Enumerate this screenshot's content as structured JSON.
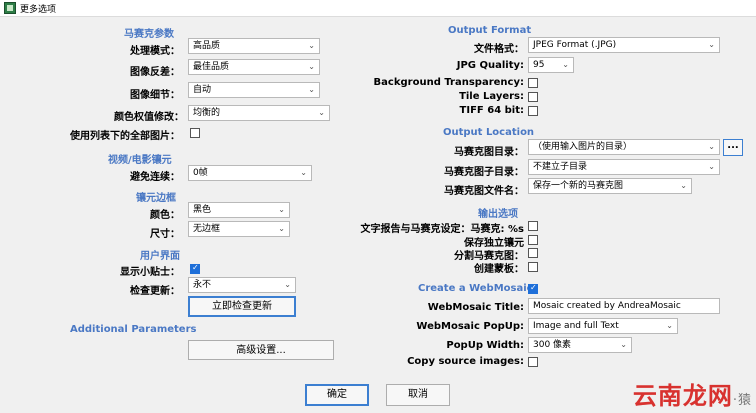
{
  "window": {
    "title": "更多选项"
  },
  "left": {
    "mosaic_params": {
      "title": "马赛克参数",
      "processing_mode": {
        "label": "处理模式：",
        "value": "高品质"
      },
      "image_inversion": {
        "label": "图像反差：",
        "value": "最佳品质"
      },
      "image_detail": {
        "label": "图像细节：",
        "value": "自动"
      },
      "color_weight": {
        "label": "颜色权值修改：",
        "value": "均衡的"
      },
      "use_all": {
        "label": "使用列表下的全部图片：",
        "checked": false
      }
    },
    "video": {
      "title": "视频/电影镶元",
      "avoid_continuous": {
        "label": "避免连续：",
        "value": "0帧"
      }
    },
    "border": {
      "title": "镶元边框",
      "color": {
        "label": "颜色：",
        "value": "黑色"
      },
      "size": {
        "label": "尺寸：",
        "value": "无边框"
      }
    },
    "ui": {
      "title": "用户界面",
      "show_tips": {
        "label": "显示小贴士：",
        "checked": true
      },
      "check_update": {
        "label": "检查更新：",
        "value": "永不"
      },
      "check_now": "立即检查更新"
    },
    "additional": {
      "title": "Additional Parameters",
      "advanced": "高级设置..."
    }
  },
  "right": {
    "output_format": {
      "title": "Output Format",
      "file_format": {
        "label": "文件格式：",
        "value": "JPEG Format (.JPG)"
      },
      "jpg_quality": {
        "label": "JPG Quality:",
        "value": "95"
      },
      "bg_transparency": {
        "label": "Background Transparency:",
        "checked": false
      },
      "tile_layers": {
        "label": "Tile Layers:",
        "checked": false
      },
      "tiff64": {
        "label": "TIFF 64 bit:",
        "checked": false
      }
    },
    "output_location": {
      "title": "Output Location",
      "mosaic_dir": {
        "label": "马赛克图目录：",
        "value": "（使用输入图片的目录）",
        "browse": "..."
      },
      "mosaic_subdir": {
        "label": "马赛克图子目录：",
        "value": "不建立子目录"
      },
      "mosaic_filename": {
        "label": "马赛克图文件名：",
        "value": "保存一个新的马赛克图"
      }
    },
    "output_options": {
      "title": "输出选项",
      "text_report": {
        "label": "文字报告与马赛克设定：马赛克: %s",
        "checked": false
      },
      "save_tiles": {
        "label": "保存独立镶元",
        "checked": false
      },
      "split_mosaic": {
        "label": "分割马赛克图：",
        "checked": false
      },
      "create_mask": {
        "label": "创建蒙板：",
        "checked": false
      }
    },
    "webmosaic": {
      "title": "Create a WebMosaic",
      "checked": true,
      "title_field": {
        "label": "WebMosaic Title:",
        "value": "Mosaic created by AndreaMosaic"
      },
      "popup": {
        "label": "WebMosaic PopUp:",
        "value": "Image and full Text"
      },
      "popup_width": {
        "label": "PopUp Width:",
        "value": "300 像素"
      },
      "copy_source": {
        "label": "Copy source images:",
        "checked": false
      }
    }
  },
  "footer": {
    "ok": "确定",
    "cancel": "取消"
  },
  "watermark": {
    "text": "云南龙网",
    "suffix": "·猿"
  }
}
